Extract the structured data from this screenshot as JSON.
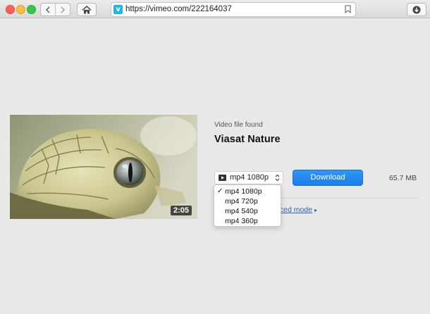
{
  "browser": {
    "url": "https://vimeo.com/222164037",
    "site_badge": "v"
  },
  "video": {
    "found_label": "Video file found",
    "title": "Viasat Nature",
    "duration": "2:05"
  },
  "format_select": {
    "selected": "mp4 1080p",
    "options": [
      {
        "label": "mp4 1080p",
        "check": "✓"
      },
      {
        "label": "mp4 720p",
        "check": ""
      },
      {
        "label": "mp4 540p",
        "check": ""
      },
      {
        "label": "mp4 360p",
        "check": ""
      }
    ]
  },
  "download_button": {
    "label": "Download"
  },
  "file_size": "65.7 MB",
  "advanced_mode": {
    "label": "vanced mode",
    "arrow": "▸"
  },
  "colors": {
    "accent": "#2189f0",
    "vimeo_badge": "#1ab7ea",
    "link": "#2563b8",
    "background": "#e9e9ea"
  },
  "icons": [
    "back-icon",
    "forward-icon",
    "home-icon",
    "vimeo-icon",
    "bookmark-icon",
    "download-arrow-icon",
    "video-format-icon",
    "updown-chevron-icon",
    "checkmark-icon"
  ]
}
